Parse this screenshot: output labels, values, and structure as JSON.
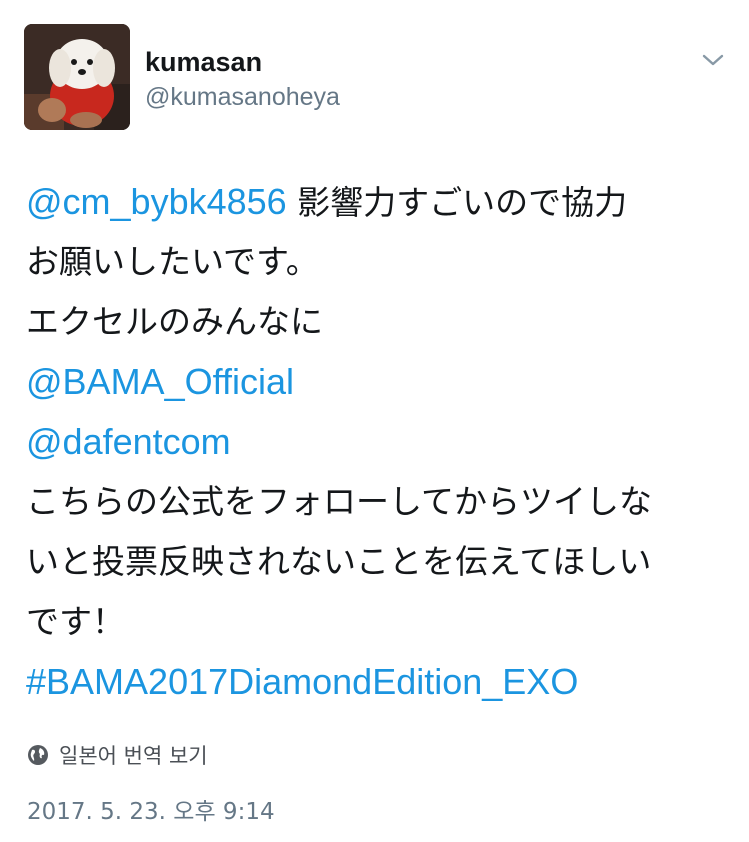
{
  "user": {
    "display_name": "kumasan",
    "handle": "@kumasanoheya"
  },
  "tweet": {
    "lines": [
      {
        "mention": "@cm_bybk4856",
        "text": " 影響力すごいので協力"
      },
      {
        "text": "お願いしたいです。"
      },
      {
        "text": "エクセルのみんなに"
      },
      {
        "mention": "@BAMA_Official"
      },
      {
        "mention": "@dafentcom"
      },
      {
        "text": "こちらの公式をフォローしてからツイしな"
      },
      {
        "text": "いと投票反映されないことを伝えてほしい"
      },
      {
        "text": "です！"
      },
      {
        "hashtag": "#BAMA2017DiamondEdition_EXO"
      }
    ]
  },
  "translate_label": "일본어 번역 보기",
  "timestamp": "2017. 5. 23. 오후 9:14",
  "icons": {
    "avatar": "dog-avatar-photo",
    "menu": "chevron-down-icon",
    "translate": "globe-icon"
  },
  "colors": {
    "link": "#1b95e0",
    "text": "#14171a",
    "secondary": "#657786"
  }
}
